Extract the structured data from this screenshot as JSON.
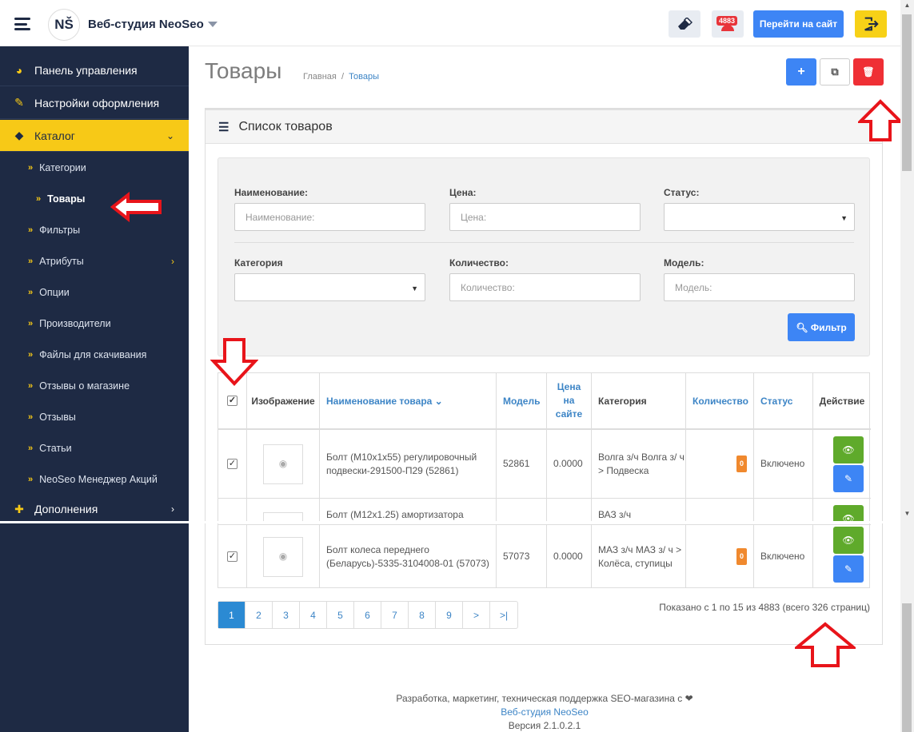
{
  "header": {
    "logo_text": "NŠ",
    "brand": "Веб-студия NeoSeo",
    "notif_count": "4883",
    "site_button": "Перейти на сайт",
    "icons": [
      "menu-icon",
      "eraser-icon",
      "bell-icon",
      "exit-icon"
    ],
    "colors": {
      "accent_yellow": "#f7c917",
      "primary_blue": "#3d85f5",
      "danger": "#ef2f35",
      "sidebar": "#1e2a44"
    }
  },
  "sidebar": {
    "main_items": [
      {
        "label": "Панель управления",
        "icon": "dashboard-icon"
      },
      {
        "label": "Настройки оформления",
        "icon": "magic-wand-icon"
      },
      {
        "label": "Каталог",
        "icon": "tags-icon",
        "active": true
      }
    ],
    "sub_items": [
      {
        "label": "Категории"
      },
      {
        "label": "Товары",
        "current": true
      },
      {
        "label": "Фильтры"
      },
      {
        "label": "Атрибуты",
        "has_children": true
      },
      {
        "label": "Опции"
      },
      {
        "label": "Производители"
      },
      {
        "label": "Файлы для скачивания"
      },
      {
        "label": "Отзывы о магазине"
      },
      {
        "label": "Отзывы"
      },
      {
        "label": "Статьи"
      },
      {
        "label": "NeoSeo Менеджер Акций"
      }
    ],
    "addons": {
      "label": "Дополнения",
      "icon": "puzzle-icon"
    }
  },
  "page": {
    "title": "Товары",
    "breadcrumb": [
      "Главная",
      "Товары"
    ],
    "toolbar": {
      "add": "+",
      "copy": "⧉",
      "delete": "🗑"
    }
  },
  "panel": {
    "title": "Список товаров",
    "filter": {
      "name_label": "Наименование:",
      "name_placeholder": "Наименование:",
      "price_label": "Цена:",
      "price_placeholder": "Цена:",
      "status_label": "Статус:",
      "status_value": "",
      "category_label": "Категория",
      "category_value": "",
      "quantity_label": "Количество:",
      "quantity_placeholder": "Количество:",
      "model_label": "Модель:",
      "model_placeholder": "Модель:",
      "button": "Фильтр"
    },
    "table": {
      "columns": [
        "Изображение",
        "Наименование товара",
        "Модель",
        "Цена на сайте",
        "Категория",
        "Количество",
        "Статус",
        "Действие"
      ],
      "rows": [
        {
          "name": "Болт (М10х1х55) регулировочный подвески-291500-П29 (52861)",
          "model": "52861",
          "price": "0.0000",
          "category": "Волга з/ч Волга з/ ч > Подвеска",
          "quantity": "0",
          "status": "Включено"
        },
        {
          "name": "Болт (М12х1.25) амортизатора",
          "model": "",
          "price": "",
          "category": "ВАЗ з/ч",
          "quantity": "",
          "status": ""
        },
        {
          "name": "Болт колеса переднего (Беларусь)-5335-3104008-01 (57073)",
          "model": "57073",
          "price": "0.0000",
          "category": "МАЗ з/ч МАЗ з/ ч > Колёса, ступицы",
          "quantity": "0",
          "status": "Включено"
        }
      ]
    },
    "pagination": [
      "1",
      "2",
      "3",
      "4",
      "5",
      "6",
      "7",
      "8",
      "9",
      ">",
      ">|"
    ],
    "current_page": "1",
    "shown_text": "Показано с 1 по 15 из 4883 (всего 326 страниц)"
  },
  "footer": {
    "line1": "Разработка, маркетинг, техническая поддержка SEO-магазина с ❤",
    "link": "Веб-студия NeoSeo",
    "version": "Версия 2.1.0.2.1"
  }
}
